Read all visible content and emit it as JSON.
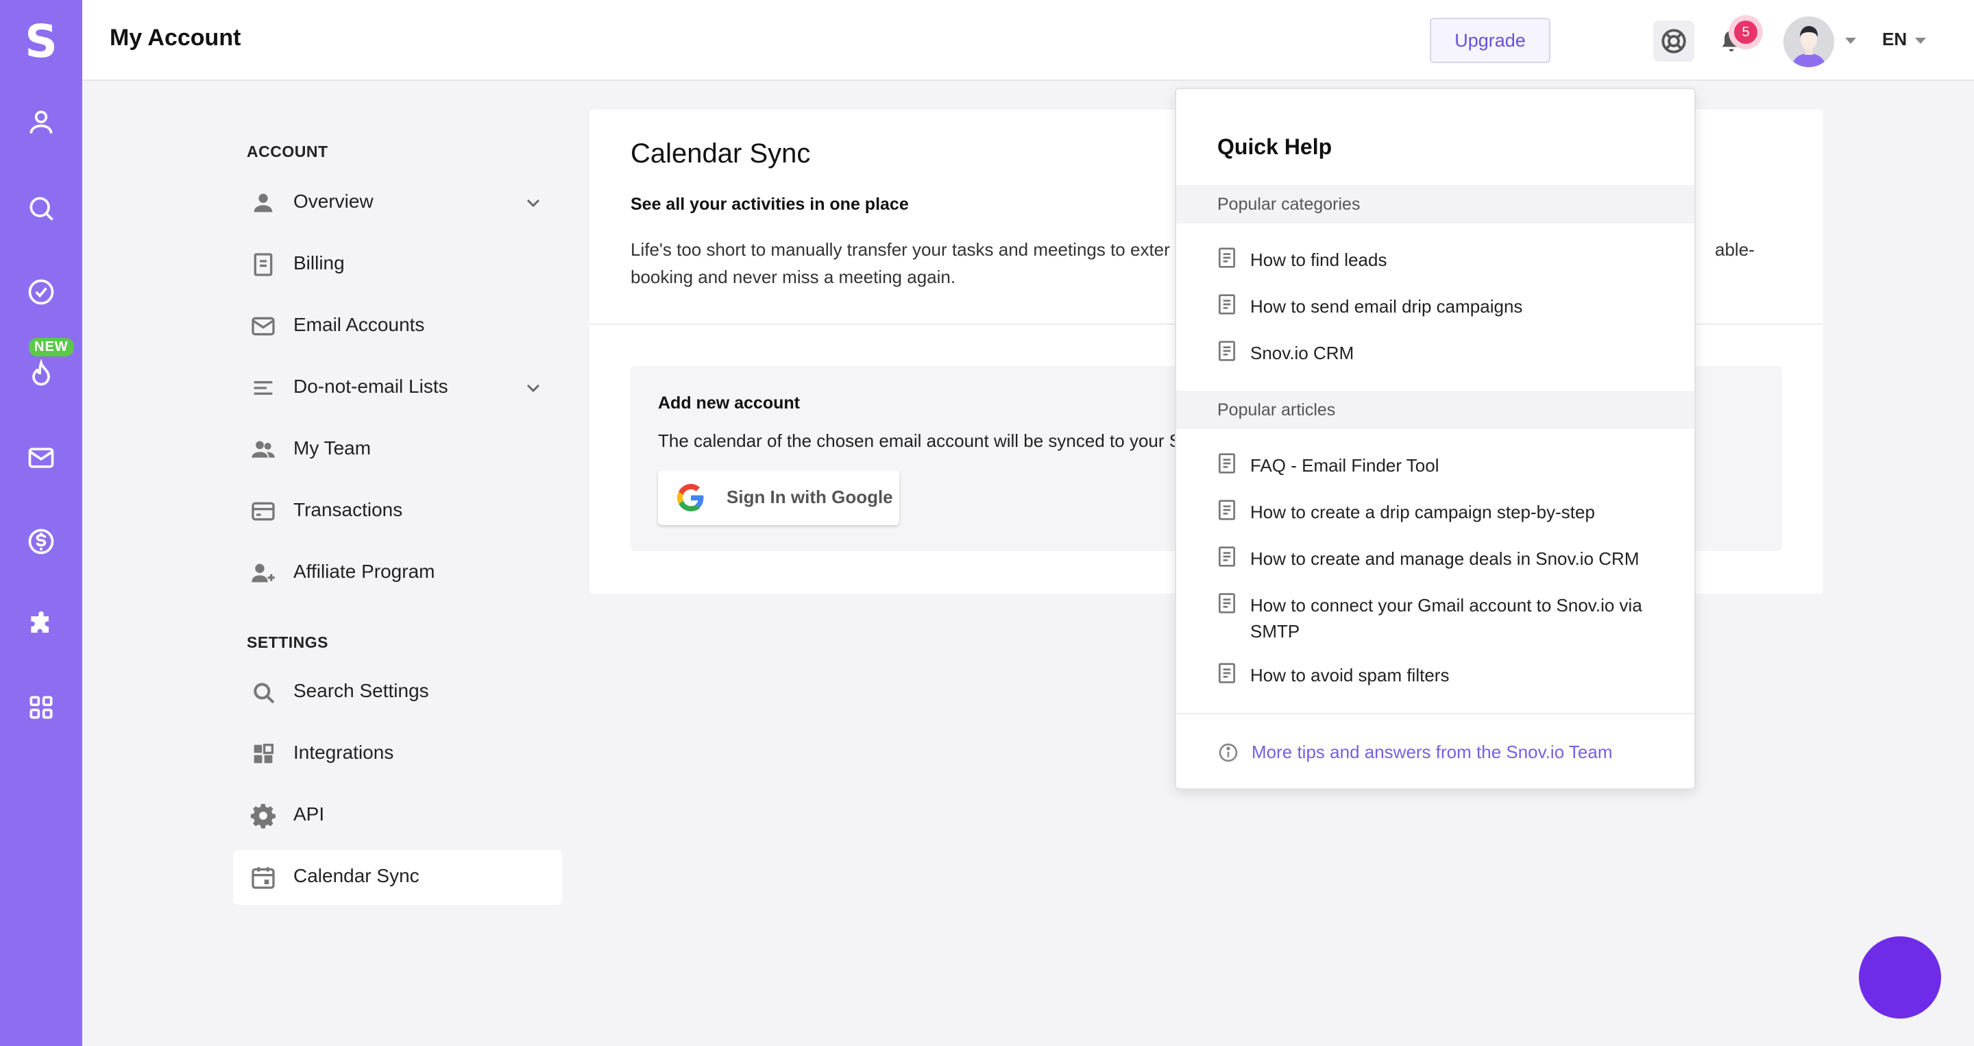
{
  "app": {
    "logo": "S",
    "new_badge": "NEW"
  },
  "header": {
    "title": "My Account",
    "upgrade_label": "Upgrade",
    "notification_count": "5",
    "language": "EN"
  },
  "nav": {
    "account_heading": "ACCOUNT",
    "account_items": [
      {
        "label": "Overview",
        "icon": "person-icon"
      },
      {
        "label": "Billing",
        "icon": "invoice-icon"
      },
      {
        "label": "Email Accounts",
        "icon": "envelope-icon"
      },
      {
        "label": "Do-not-email Lists",
        "icon": "list-icon"
      },
      {
        "label": "My Team",
        "icon": "team-icon"
      },
      {
        "label": "Transactions",
        "icon": "card-icon"
      },
      {
        "label": "Affiliate Program",
        "icon": "add-person-icon"
      }
    ],
    "settings_heading": "SETTINGS",
    "settings_items": [
      {
        "label": "Search Settings",
        "icon": "search-icon"
      },
      {
        "label": "Integrations",
        "icon": "grid-icon"
      },
      {
        "label": "API",
        "icon": "gear-icon"
      },
      {
        "label": "Calendar Sync",
        "icon": "calendar-icon"
      }
    ],
    "active": "Calendar Sync"
  },
  "main": {
    "title": "Calendar Sync",
    "subtitle": "See all your activities in one place",
    "description": "Life's too short to manually transfer your tasks and meetings to exter… able-booking and never miss a meeting again.",
    "description_line1": "Life's too short to manually transfer your tasks and meetings to exter",
    "description_line1_tail": "able-",
    "description_line2": "booking and never miss a meeting again.",
    "add_account": {
      "title": "Add new account",
      "description": "The calendar of the chosen email account will be synced to your S",
      "google_button": "Sign In with Google"
    }
  },
  "quick_help": {
    "title": "Quick Help",
    "categories_heading": "Popular categories",
    "categories": [
      "How to find leads",
      "How to send email drip campaigns",
      "Snov.io CRM"
    ],
    "articles_heading": "Popular articles",
    "articles": [
      "FAQ - Email Finder Tool",
      "How to create a drip campaign step-by-step",
      "How to create and manage deals in Snov.io CRM",
      "How to connect your Gmail account to Snov.io via SMTP",
      "How to avoid spam filters"
    ],
    "more_link": "More tips and answers from the Snov.io Team"
  },
  "colors": {
    "rail": "#8e6ef0",
    "accent": "#6b4fd8",
    "badge": "#e8336b",
    "new_badge": "#5cc84a",
    "chat": "#6f2ce8"
  }
}
